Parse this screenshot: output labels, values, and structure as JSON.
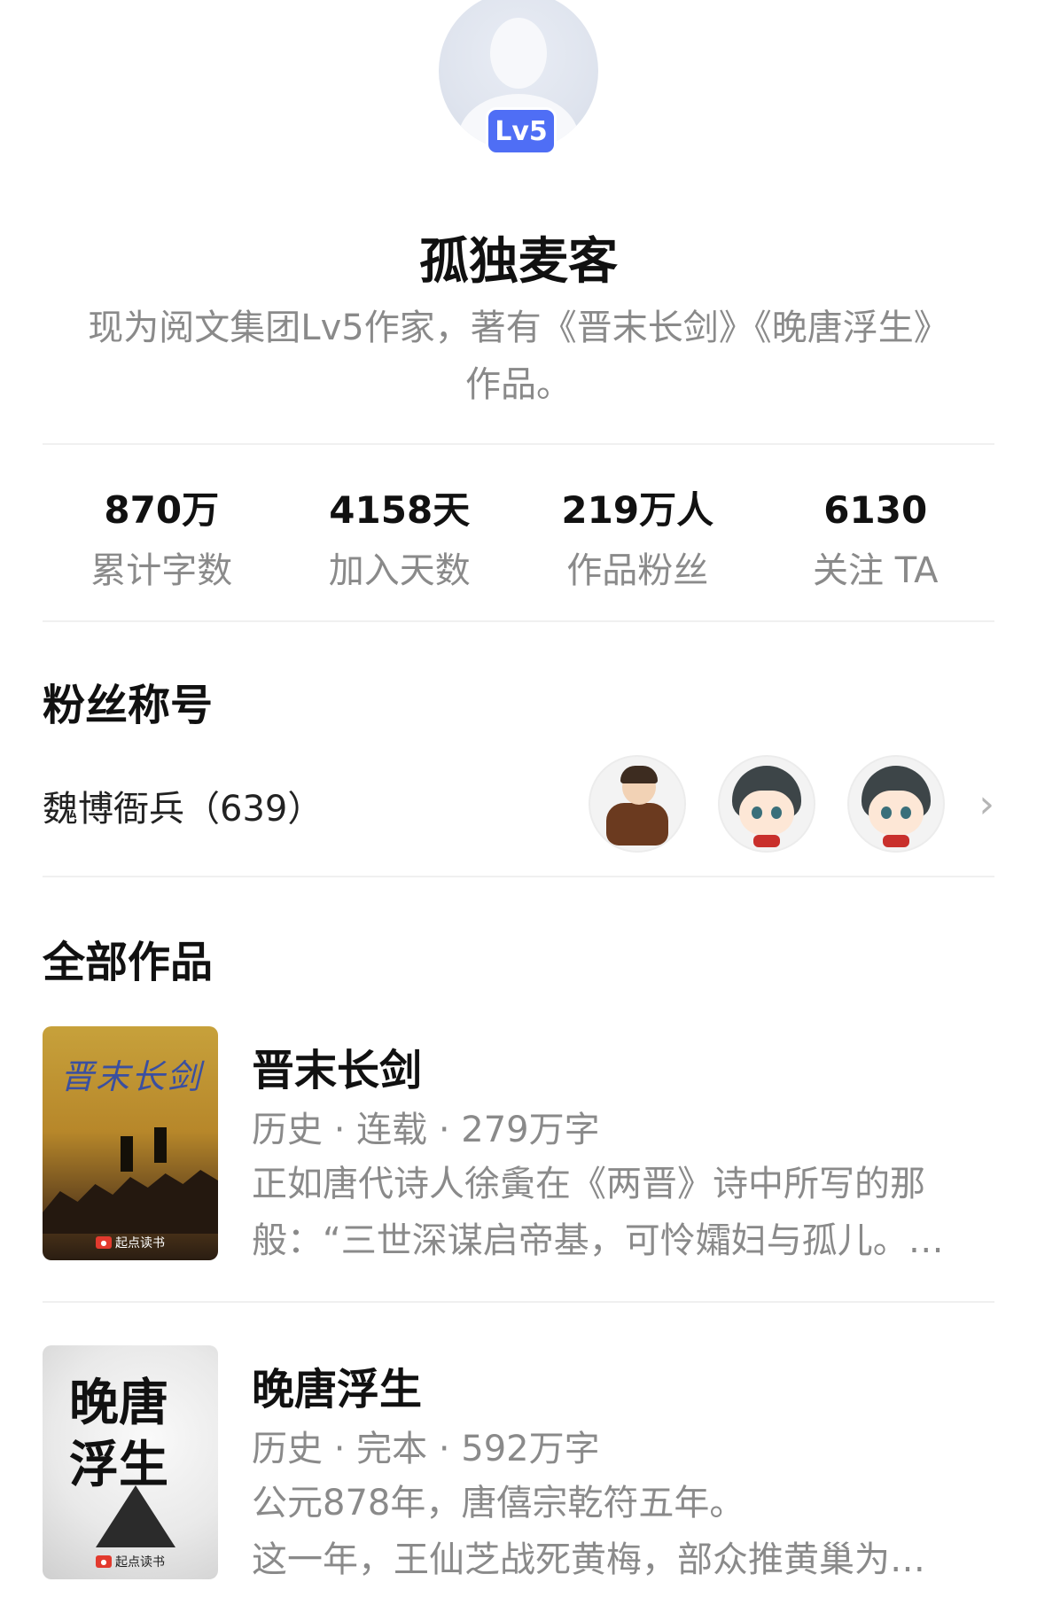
{
  "profile": {
    "level_badge": "Lv5",
    "name": "孤独麦客",
    "bio_line1": "现为阅文集团Lv5作家，著有《晋末长剑》《晚唐浮生》",
    "bio_line2": "作品。"
  },
  "stats": [
    {
      "value": "870万",
      "label": "累计字数"
    },
    {
      "value": "4158天",
      "label": "加入天数"
    },
    {
      "value": "219万人",
      "label": "作品粉丝"
    },
    {
      "value": "6130",
      "label": "关注 TA"
    }
  ],
  "fan_section": {
    "title": "粉丝称号",
    "fan_title": "魏博衙兵（639）",
    "chevron": "›"
  },
  "works_section": {
    "title": "全部作品",
    "books": [
      {
        "title": "晋末长剑",
        "meta": "历史 · 连载 · 279万字",
        "desc_line1": "正如唐代诗人徐夤在《两晋》诗中所写的那",
        "desc_line2": "般：“三世深谋启帝基，可怜孀妇与孤儿。…",
        "cover_title": "晋末长剑",
        "cover_logo": "起点读书"
      },
      {
        "title": "晚唐浮生",
        "meta": "历史 · 完本 · 592万字",
        "desc_line1": "公元878年，唐僖宗乾符五年。",
        "desc_line2": "这一年，王仙芝战死黄梅，部众推黄巢为…",
        "cover_title": "晚唐浮生",
        "cover_logo": "起点读书"
      }
    ]
  }
}
